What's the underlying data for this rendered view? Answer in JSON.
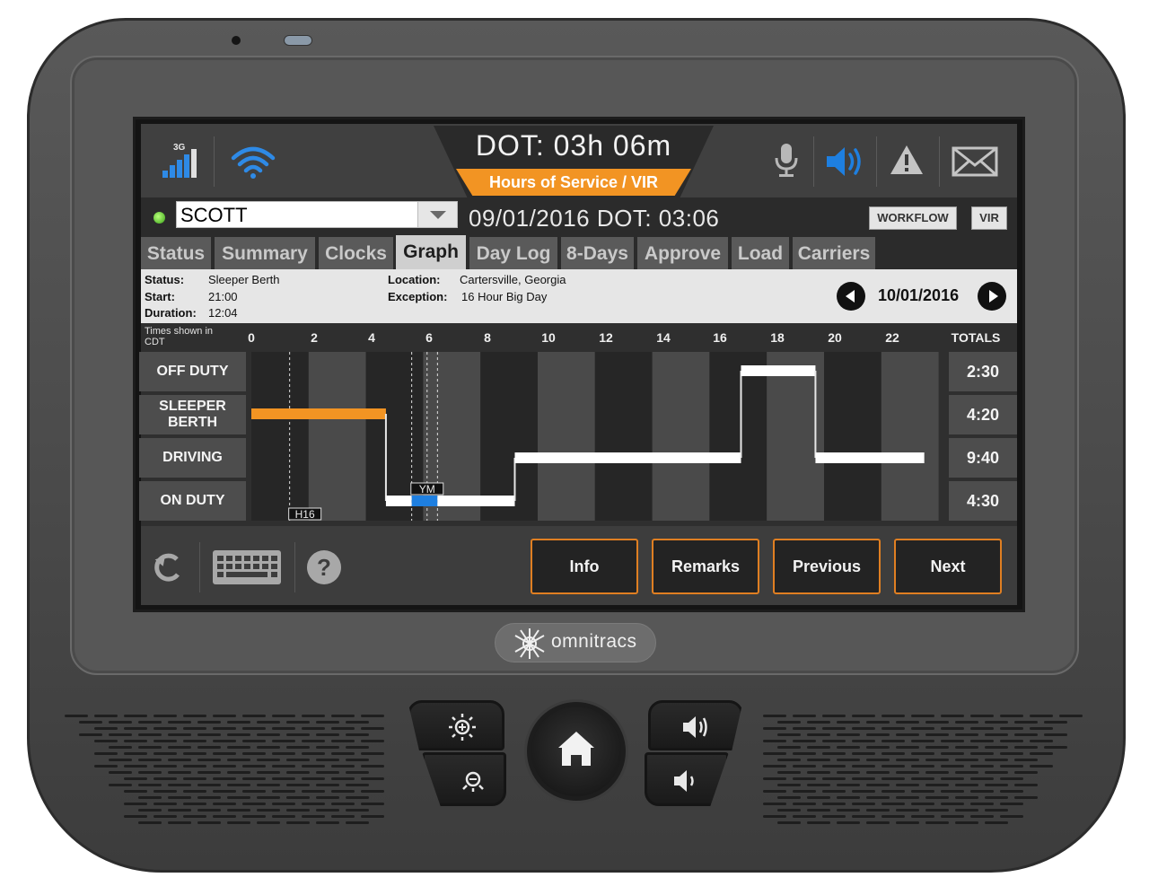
{
  "status_bar": {
    "network_label": "3G",
    "dot_title": "DOT:  03h 06m",
    "mode_banner": "Hours of Service / VIR",
    "icons": [
      "signal-bars-icon",
      "wifi-icon",
      "microphone-icon",
      "speaker-icon",
      "warning-icon",
      "mail-icon"
    ],
    "accent_color": "#f29423",
    "speaker_color": "#1e7fe0"
  },
  "driver": {
    "name": "SCOTT",
    "date_dot": "09/01/2016   DOT:  03:06",
    "status_color": "#38a317",
    "workflow_label": "WORKFLOW",
    "vir_label": "VIR"
  },
  "tabs": [
    {
      "label": "Status",
      "active": false
    },
    {
      "label": "Summary",
      "active": false
    },
    {
      "label": "Clocks",
      "active": false
    },
    {
      "label": "Graph",
      "active": true
    },
    {
      "label": "Day Log",
      "active": false
    },
    {
      "label": "8-Days",
      "active": false
    },
    {
      "label": "Approve",
      "active": false
    },
    {
      "label": "Load",
      "active": false
    },
    {
      "label": "Carriers",
      "active": false
    }
  ],
  "info": {
    "status_label": "Status:",
    "status_value": "Sleeper Berth",
    "start_label": "Start:",
    "start_value": "21:00",
    "duration_label": "Duration:",
    "duration_value": "12:04",
    "location_label": "Location:",
    "location_value": "Cartersville, Georgia",
    "exception_label": "Exception:",
    "exception_value": "16 Hour Big Day",
    "nav_date": "10/01/2016"
  },
  "graph": {
    "timezone_note": "Times shown in CDT",
    "hour_labels": [
      "0",
      "2",
      "4",
      "6",
      "8",
      "10",
      "12",
      "14",
      "16",
      "18",
      "20",
      "22"
    ],
    "totals_header": "TOTALS",
    "rows": [
      {
        "label": "OFF DUTY",
        "total": "2:30"
      },
      {
        "label": "SLEEPER BERTH",
        "total": "4:20"
      },
      {
        "label": "DRIVING",
        "total": "9:40"
      },
      {
        "label": "ON DUTY",
        "total": "4:30"
      }
    ],
    "markers": [
      {
        "label": "H16",
        "hour": 1.4
      },
      {
        "label": "YM",
        "hour": 6.2
      }
    ]
  },
  "chart_data": {
    "type": "line",
    "title": "",
    "x_unit": "hour of day",
    "xlim": [
      0,
      24
    ],
    "categories": [
      "OFF DUTY",
      "SLEEPER BERTH",
      "DRIVING",
      "ON DUTY"
    ],
    "segments": [
      {
        "status": "SLEEPER BERTH",
        "start": 0.0,
        "end": 4.7,
        "color": "#f29423"
      },
      {
        "status": "ON DUTY",
        "start": 4.7,
        "end": 5.6,
        "color": "#ffffff"
      },
      {
        "status": "ON DUTY",
        "start": 5.6,
        "end": 6.5,
        "color": "#1e7fe0"
      },
      {
        "status": "ON DUTY",
        "start": 6.5,
        "end": 9.2,
        "color": "#ffffff"
      },
      {
        "status": "DRIVING",
        "start": 9.2,
        "end": 17.1,
        "color": "#ffffff"
      },
      {
        "status": "OFF DUTY",
        "start": 17.1,
        "end": 19.7,
        "color": "#ffffff"
      },
      {
        "status": "DRIVING",
        "start": 19.7,
        "end": 23.5,
        "color": "#ffffff"
      }
    ]
  },
  "actions": {
    "info": "Info",
    "remarks": "Remarks",
    "previous": "Previous",
    "next": "Next",
    "toolbar_icons": [
      "refresh-icon",
      "keyboard-icon",
      "help-icon"
    ]
  },
  "brand": {
    "logo_text": "omnitracs"
  }
}
